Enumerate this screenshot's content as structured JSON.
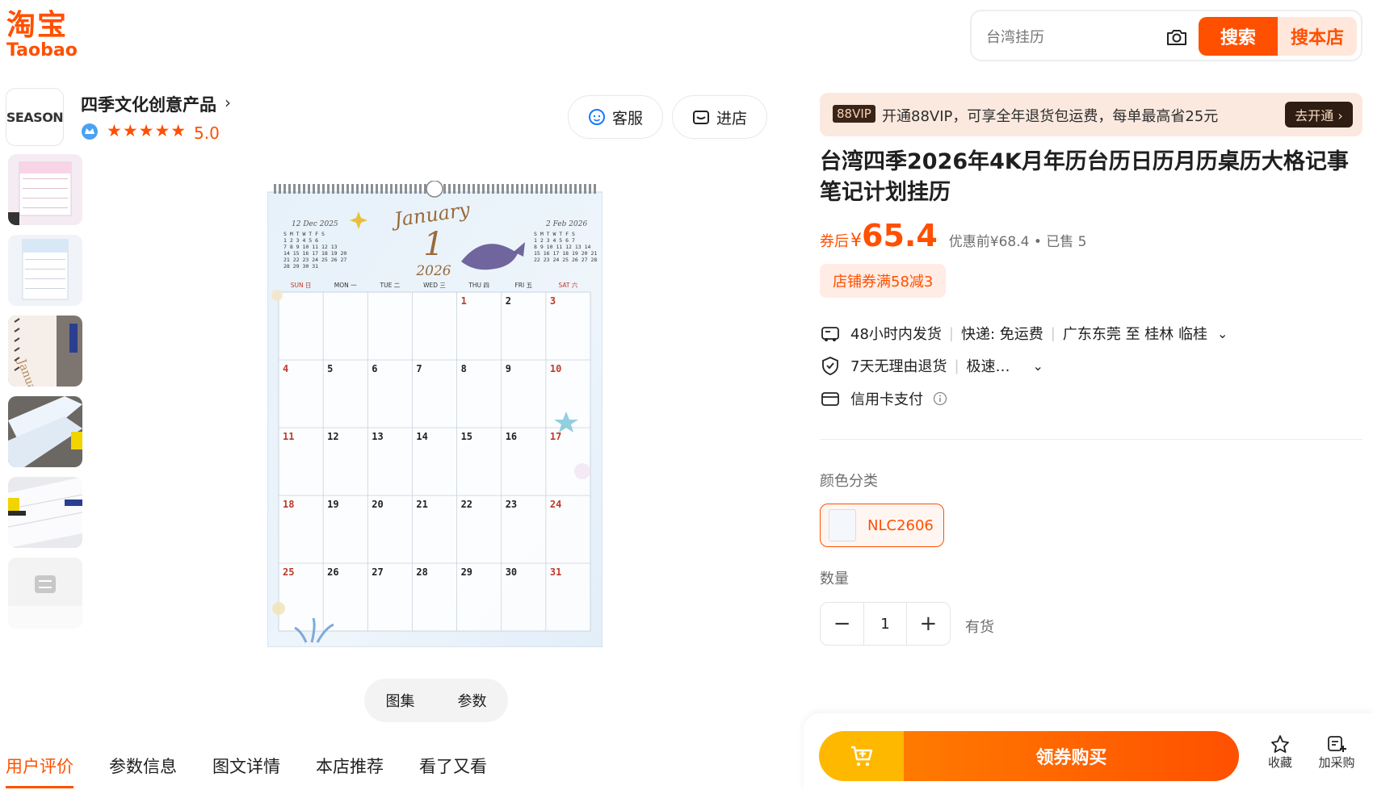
{
  "brand": {
    "cn": "淘宝",
    "en": "Taobao",
    "color": "#ff5000"
  },
  "search": {
    "placeholder": "台湾挂历",
    "search_label": "搜索",
    "store_search_label": "搜本店"
  },
  "shop": {
    "logo_text": "SEASON",
    "name": "四季文化创意产品",
    "chevron": "›",
    "stars": "★★★★★",
    "rating": "5.0",
    "service_label": "客服",
    "enter_label": "进店"
  },
  "gallery": {
    "tabs": [
      "图集",
      "参数"
    ],
    "thumbnail_count": 6
  },
  "calendar_image": {
    "month_name": "January",
    "month_num": "1",
    "year": "2026",
    "weekdays": [
      "SUN 日",
      "MON 一",
      "TUE 二",
      "WED 三",
      "THU 四",
      "FRI 五",
      "SAT 六"
    ],
    "prev_mini": "12 Dec 2025",
    "next_mini": "2 Feb 2026",
    "days": [
      "1",
      "2",
      "3",
      "4",
      "5",
      "6",
      "7",
      "8",
      "9",
      "10",
      "11",
      "12",
      "13",
      "14",
      "15",
      "16",
      "17",
      "18",
      "19",
      "20",
      "21",
      "22",
      "23",
      "24",
      "25",
      "26",
      "27",
      "28",
      "29",
      "30",
      "31"
    ]
  },
  "detail_tabs": [
    "用户评价",
    "参数信息",
    "图文详情",
    "本店推荐",
    "看了又看"
  ],
  "vip": {
    "tag": "88VIP",
    "text": "开通88VIP，可享全年退货包运费，每单最高省25元",
    "button": "去开通 ›"
  },
  "product": {
    "title": "台湾四季2026年4K月年历台历日历月历桌历大格记事笔记计划挂历",
    "price_label": "券后",
    "currency": "¥",
    "price": "65.4",
    "original": "优惠前¥68.4 • 已售 5",
    "coupon": "店铺券满58减3"
  },
  "delivery": {
    "ship_time": "48小时内发货",
    "express": "快递: 免运费",
    "route": "广东东莞 至 桂林 临桂",
    "returns": "7天无理由退货",
    "refund": "极速…",
    "payment": "信用卡支付"
  },
  "sku": {
    "label": "颜色分类",
    "option": "NLC2606"
  },
  "quantity": {
    "label": "数量",
    "value": "1",
    "minus": "−",
    "plus": "+",
    "stock": "有货"
  },
  "actions": {
    "buy": "领券购买",
    "favorite": "收藏",
    "add_purchase": "加采购"
  }
}
